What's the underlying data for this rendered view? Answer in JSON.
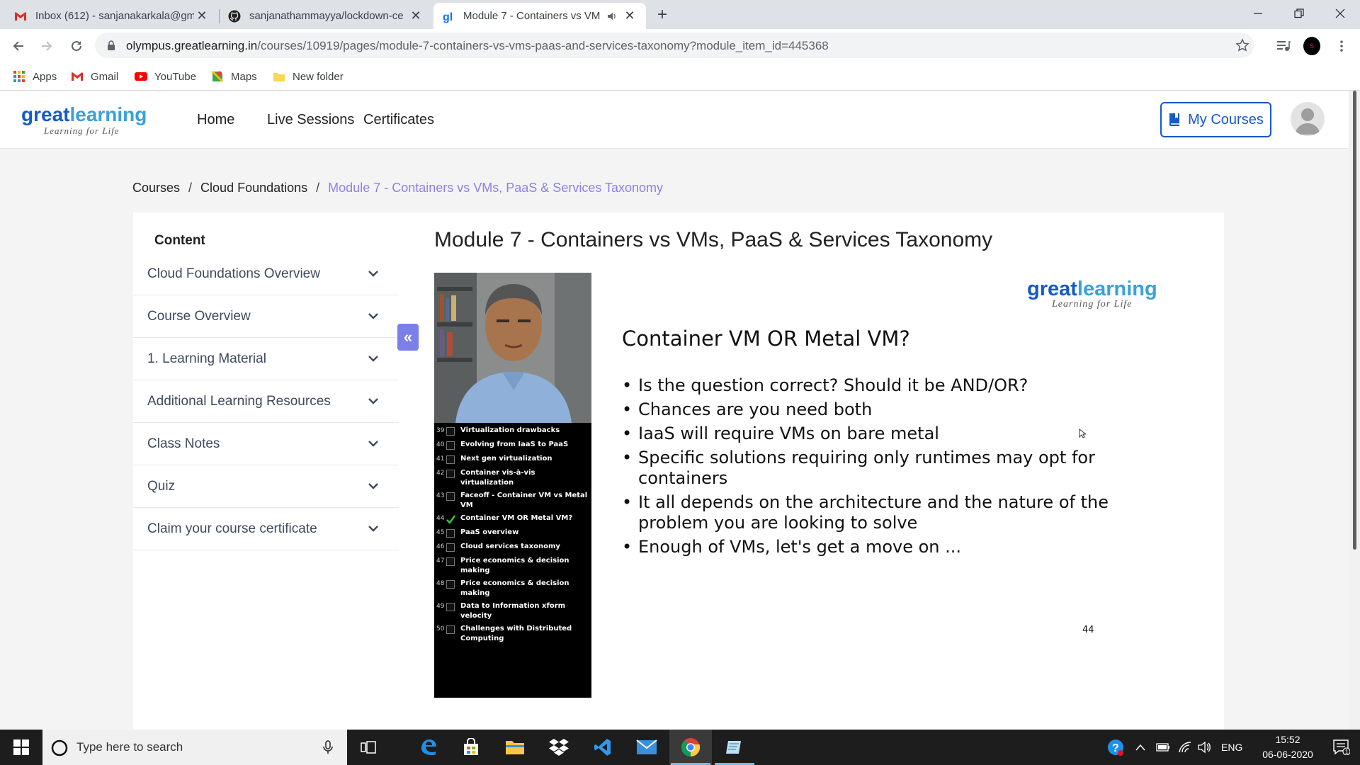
{
  "browser": {
    "tabs": [
      {
        "title": "Inbox (612) - sanjanakarkala@gm",
        "icon": "gmail-icon"
      },
      {
        "title": "sanjanathammayya/lockdown-ce",
        "icon": "github-icon"
      },
      {
        "title": "Module 7 - Containers vs VM",
        "icon": "greatlearning-icon",
        "active": true,
        "audio": true
      }
    ],
    "url_host": "olympus.greatlearning.in",
    "url_path": "/courses/10919/pages/module-7-containers-vs-vms-paas-and-services-taxonomy?module_item_id=445368",
    "profile_initial": "S",
    "bookmarks": [
      {
        "label": "Apps",
        "icon": "apps-grid-icon"
      },
      {
        "label": "Gmail",
        "icon": "gmail-icon"
      },
      {
        "label": "YouTube",
        "icon": "youtube-icon"
      },
      {
        "label": "Maps",
        "icon": "maps-icon"
      },
      {
        "label": "New folder",
        "icon": "folder-icon"
      }
    ]
  },
  "site": {
    "logo_main": "greatlearning",
    "logo_sub": "Learning for Life",
    "nav": [
      "Home",
      "Live Sessions",
      "Certificates"
    ],
    "my_courses": "My Courses"
  },
  "breadcrumb": {
    "items": [
      "Courses",
      "Cloud Foundations"
    ],
    "current": "Module 7 - Containers vs VMs, PaaS & Services Taxonomy",
    "separator": "/"
  },
  "sidebar": {
    "title": "Content",
    "collapse_glyph": "«",
    "items": [
      "Cloud Foundations Overview",
      "Course Overview",
      "1. Learning Material",
      "Additional Learning Resources",
      "Class Notes",
      "Quiz",
      "Claim your course certificate"
    ]
  },
  "module": {
    "title": "Module 7 - Containers vs VMs, PaaS & Services Taxonomy"
  },
  "video": {
    "chapters": [
      {
        "num": "39",
        "title": "Virtualization drawbacks",
        "checked": false
      },
      {
        "num": "40",
        "title": "Evolving from IaaS to PaaS",
        "checked": false
      },
      {
        "num": "41",
        "title": "Next gen virtualization",
        "checked": false
      },
      {
        "num": "42",
        "title": "Container vis-à-vis virtualization",
        "checked": false
      },
      {
        "num": "43",
        "title": "Faceoff - Container VM vs Metal VM",
        "checked": false
      },
      {
        "num": "44",
        "title": "Container VM OR Metal VM?",
        "checked": true
      },
      {
        "num": "45",
        "title": "PaaS overview",
        "checked": false
      },
      {
        "num": "46",
        "title": "Cloud services taxonomy",
        "checked": false
      },
      {
        "num": "47",
        "title": "Price economics & decision making",
        "checked": false
      },
      {
        "num": "48",
        "title": "Price economics & decision making",
        "checked": false
      },
      {
        "num": "49",
        "title": "Data to Information xform velocity",
        "checked": false
      },
      {
        "num": "50",
        "title": "Challenges with Distributed Computing",
        "checked": false
      }
    ],
    "slide": {
      "logo_main": "greatlearning",
      "logo_sub": "Learning for Life",
      "title": "Container VM OR Metal VM?",
      "bullets": [
        "Is the question correct? Should it be AND/OR?",
        "Chances are you need both",
        "IaaS will require VMs on bare metal",
        "Specific solutions requiring only runtimes may opt for containers",
        "It all depends on the architecture and the nature of the problem you are looking to solve",
        "Enough of VMs, let's get a move on ..."
      ],
      "page_number": "44"
    }
  },
  "taskbar": {
    "search_placeholder": "Type here to search",
    "language": "ENG",
    "time": "15:52",
    "date": "06-06-2020",
    "notification_count": "1"
  },
  "colors": {
    "brand_blue": "#1659c9",
    "brand_accent": "#3aa1d8",
    "breadcrumb_current": "#8b83e6",
    "collapse_button": "#7b7fe8"
  }
}
